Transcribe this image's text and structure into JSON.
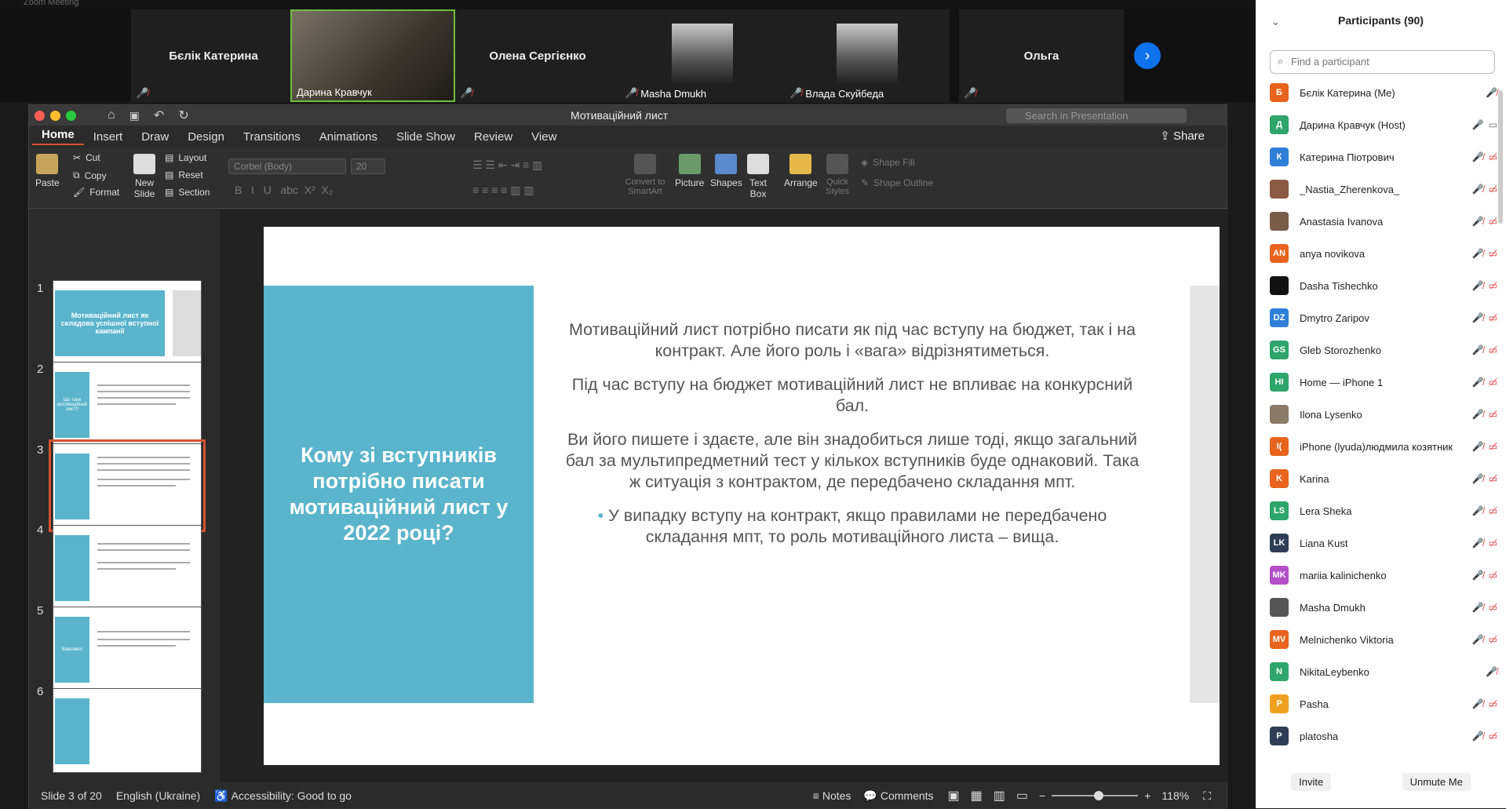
{
  "zoom": {
    "window_title": "Zoom Meeting",
    "participants_strip": [
      {
        "name": "Бєлік Катерина",
        "video": false,
        "muted": true
      },
      {
        "name": "Дарина Кравчук",
        "video": true,
        "muted": false
      },
      {
        "name": "Олена Сергієнко",
        "video": false,
        "muted": true
      },
      {
        "name": "Masha Dmukh",
        "video": true,
        "muted": true
      },
      {
        "name": "Влада Скуйбеда",
        "video": true,
        "muted": true
      },
      {
        "name": "Ольга",
        "video": false,
        "muted": true
      }
    ]
  },
  "ppt": {
    "title": "Мотиваційний лист",
    "search_placeholder": "Search in Presentation",
    "share_label": "Share",
    "tabs": [
      "Home",
      "Insert",
      "Draw",
      "Design",
      "Transitions",
      "Animations",
      "Slide Show",
      "Review",
      "View"
    ],
    "ribbon": {
      "paste": "Paste",
      "cut": "Cut",
      "copy": "Copy",
      "format": "Format",
      "new_slide": "New Slide",
      "layout": "Layout",
      "reset": "Reset",
      "section": "Section",
      "font": "Corbel (Body)",
      "size": "20",
      "convert_smartart": "Convert to SmartArt",
      "picture": "Picture",
      "shapes": "Shapes",
      "text_box": "Text Box",
      "arrange": "Arrange",
      "quick_styles": "Quick Styles",
      "shape_fill": "Shape Fill",
      "shape_outline": "Shape Outline"
    },
    "thumbnails": [
      {
        "num": "1",
        "text": "Мотиваційний лист як складова успішної вступної кампанії"
      },
      {
        "num": "2",
        "text": "Що таке мотиваційний лист?"
      },
      {
        "num": "3",
        "text": ""
      },
      {
        "num": "4",
        "text": ""
      },
      {
        "num": "5",
        "text": "Важливо!"
      },
      {
        "num": "6",
        "text": ""
      }
    ],
    "slide": {
      "heading": "Кому зі вступників потрібно писати мотиваційний лист у 2022 році?",
      "para1": "Мотиваційний лист потрібно писати як під час вступу на бюджет, так і на контракт. Але його роль і «вага» відрізнятиметься.",
      "para2": "Під час вступу на бюджет мотиваційний лист не впливає на конкурсний бал.",
      "para3": "Ви його пишете і здаєте, але він знадобиться лише тоді, якщо загальний бал за мультипредметний тест у кількох вступників буде однаковий. Така ж ситуація з контрактом, де передбачено складання мпт.",
      "para4": "У випадку вступу на контракт, якщо правилами не передбачено  складання мпт, то роль мотиваційного листа – вища."
    },
    "status": {
      "slide": "Slide 3 of 20",
      "language": "English (Ukraine)",
      "accessibility": "Accessibility: Good to go",
      "notes": "Notes",
      "comments": "Comments",
      "zoom": "118%"
    }
  },
  "panel": {
    "title": "Participants (90)",
    "find_placeholder": "Find a participant",
    "participants": [
      {
        "initials": "Б",
        "name": "Бєлік Катерина (Me)",
        "color": "#e8641e",
        "video_off": false
      },
      {
        "initials": "Д",
        "name": "Дарина Кравчук (Host)",
        "color": "#2ea56a",
        "video_off": false,
        "host": true
      },
      {
        "initials": "К",
        "name": " Катерина Піотрович",
        "color": "#2f7fd9",
        "video_off": true
      },
      {
        "initials": "",
        "name": "_Nastia_Zherenkova_",
        "color": "#8a5a44",
        "video_off": true
      },
      {
        "initials": "",
        "name": "Anastasia Ivanova",
        "color": "#7a5b4a",
        "video_off": true
      },
      {
        "initials": "AN",
        "name": "anya novikova",
        "color": "#e8641e",
        "video_off": true
      },
      {
        "initials": "",
        "name": "Dasha Tishechko",
        "color": "#111111",
        "video_off": true
      },
      {
        "initials": "DZ",
        "name": "Dmytro Zaripov",
        "color": "#2f7fd9",
        "video_off": true
      },
      {
        "initials": "GS",
        "name": "Gleb Storozhenko",
        "color": "#2ea56a",
        "video_off": true
      },
      {
        "initials": "HI",
        "name": "Home — iPhone 1",
        "color": "#2ea56a",
        "video_off": true
      },
      {
        "initials": "",
        "name": "Ilona Lysenko",
        "color": "#8a7a6a",
        "video_off": true
      },
      {
        "initials": "I(",
        "name": "iPhone (lyuda)людмила козятник",
        "color": "#e8641e",
        "video_off": true
      },
      {
        "initials": "K",
        "name": "Karina",
        "color": "#e8641e",
        "video_off": true
      },
      {
        "initials": "LS",
        "name": "Lera Sheka",
        "color": "#2ea56a",
        "video_off": true
      },
      {
        "initials": "LK",
        "name": "Liana Kust",
        "color": "#2f3e56",
        "video_off": true
      },
      {
        "initials": "MK",
        "name": "mariia kalinichenko",
        "color": "#b24fc9",
        "video_off": true
      },
      {
        "initials": "",
        "name": "Masha Dmukh",
        "color": "#555555",
        "video_off": true
      },
      {
        "initials": "MV",
        "name": "Melnichenko Viktoria",
        "color": "#e8641e",
        "video_off": true
      },
      {
        "initials": "N",
        "name": "NikitaLeybenko",
        "color": "#2ea56a",
        "video_off": false
      },
      {
        "initials": "P",
        "name": "Pasha",
        "color": "#f0a020",
        "video_off": true
      },
      {
        "initials": "P",
        "name": "platosha",
        "color": "#2f3e56",
        "video_off": true
      }
    ],
    "invite": "Invite",
    "unmute_me": "Unmute Me"
  }
}
